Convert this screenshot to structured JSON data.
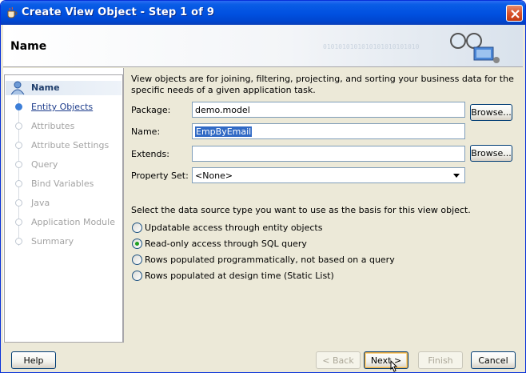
{
  "window": {
    "title": "Create View Object - Step 1 of 9"
  },
  "header": {
    "title": "Name",
    "binary": "0101010101010101010101010"
  },
  "steps": [
    {
      "label": "Name",
      "state": "active"
    },
    {
      "label": "Entity Objects",
      "state": "link"
    },
    {
      "label": "Attributes",
      "state": "disabled"
    },
    {
      "label": "Attribute Settings",
      "state": "disabled"
    },
    {
      "label": "Query",
      "state": "disabled"
    },
    {
      "label": "Bind Variables",
      "state": "disabled"
    },
    {
      "label": "Java",
      "state": "disabled"
    },
    {
      "label": "Application Module",
      "state": "disabled"
    },
    {
      "label": "Summary",
      "state": "disabled"
    }
  ],
  "form": {
    "description": "View objects are for joining, filtering, projecting, and sorting your business data for the specific needs of a given application task.",
    "package_label": "Package:",
    "package_value": "demo.model",
    "name_label": "Name:",
    "name_value": "EmpByEmail",
    "extends_label": "Extends:",
    "extends_value": "",
    "property_set_label": "Property Set:",
    "property_set_value": "<None>",
    "browse_label": "Browse...",
    "prompt": "Select the data source type you want to use as the basis for this view object."
  },
  "radios": [
    {
      "label": "Updatable access through entity objects",
      "checked": false
    },
    {
      "label": "Read-only access through SQL query",
      "checked": true
    },
    {
      "label": "Rows populated programmatically, not based on a query",
      "checked": false
    },
    {
      "label": "Rows populated at design time (Static List)",
      "checked": false
    }
  ],
  "buttons": {
    "help": "Help",
    "back": "< Back",
    "next": "Next >",
    "finish": "Finish",
    "cancel": "Cancel"
  },
  "colors": {
    "titlebar": "#0050e0",
    "selection": "#316ac5",
    "link": "#1e3d8c",
    "radio_dot": "#21a121"
  }
}
